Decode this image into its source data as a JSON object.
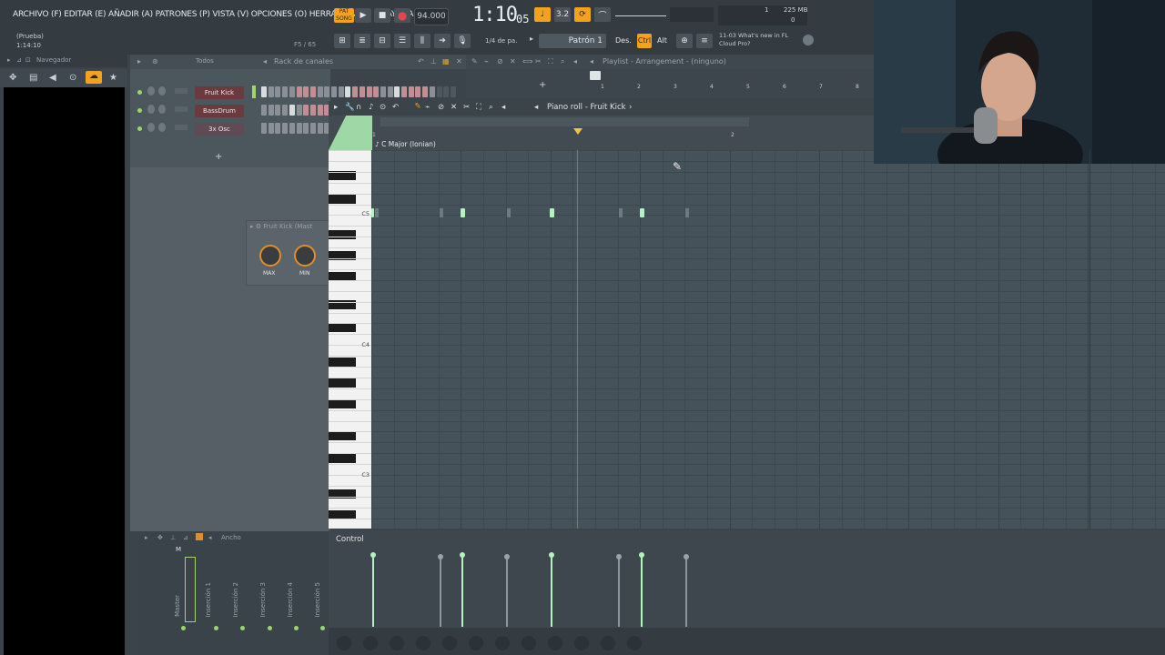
{
  "menu": {
    "text": "ARCHIVO (F) EDITAR (E) AÑADIR (A) PATRONES (P) VISTA (V) OPCIONES (O) HERRAMIENTAS (T) AYUDA"
  },
  "project": {
    "name": "(Prueba)",
    "time": "1:14:10",
    "hint": "F5 / 65"
  },
  "transport": {
    "pat_label": "PAT",
    "song_label": "SONG",
    "tempo": "94.000",
    "clock": "1:10",
    "clock_sub": "05",
    "clock_label": "B:S:T"
  },
  "status": {
    "cpu": "1",
    "cpu2": "0",
    "memory": "225 MB"
  },
  "toolbar2": {
    "snap": "1/4 de pa.",
    "pattern": "Patrón 1",
    "des": "Des.",
    "ctrl": "Ctrl",
    "alt": "Alt"
  },
  "news": {
    "date": "11-03",
    "line1": "What's new in FL",
    "line2": "Cloud Pro?"
  },
  "navigator": {
    "title": "Navegador"
  },
  "rack": {
    "title": "Rack de canales",
    "filter": "Todos",
    "channels": [
      {
        "name": "Fruit Kick"
      },
      {
        "name": "BassDrum"
      },
      {
        "name": "3x Osc"
      }
    ],
    "add": "+"
  },
  "plugin": {
    "title": "Fruit Kick (Mast",
    "knob1": "MAX",
    "knob2": "MIN"
  },
  "playlist": {
    "title": "Playlist - Arrangement - (ninguno)",
    "bars": [
      "1",
      "2",
      "3",
      "4",
      "5",
      "6",
      "7",
      "8"
    ]
  },
  "pianoroll": {
    "title": "Piano roll - Fruit Kick",
    "scale": "C Major (Ionian)",
    "ruler": [
      "1",
      "2"
    ],
    "keys": {
      "c5": "C5",
      "c4": "C4",
      "c3": "C3"
    }
  },
  "control": {
    "label": "Control"
  },
  "mixer": {
    "title": "Ancho",
    "master": "Master",
    "m_label": "M",
    "inserts": [
      "Inserción 1",
      "Inserción 2",
      "Inserción 3",
      "Inserción 4",
      "Inserción 5"
    ]
  },
  "colors": {
    "accent": "#f2a21c",
    "note": "#b4f2c0",
    "grid": "#46525a"
  }
}
